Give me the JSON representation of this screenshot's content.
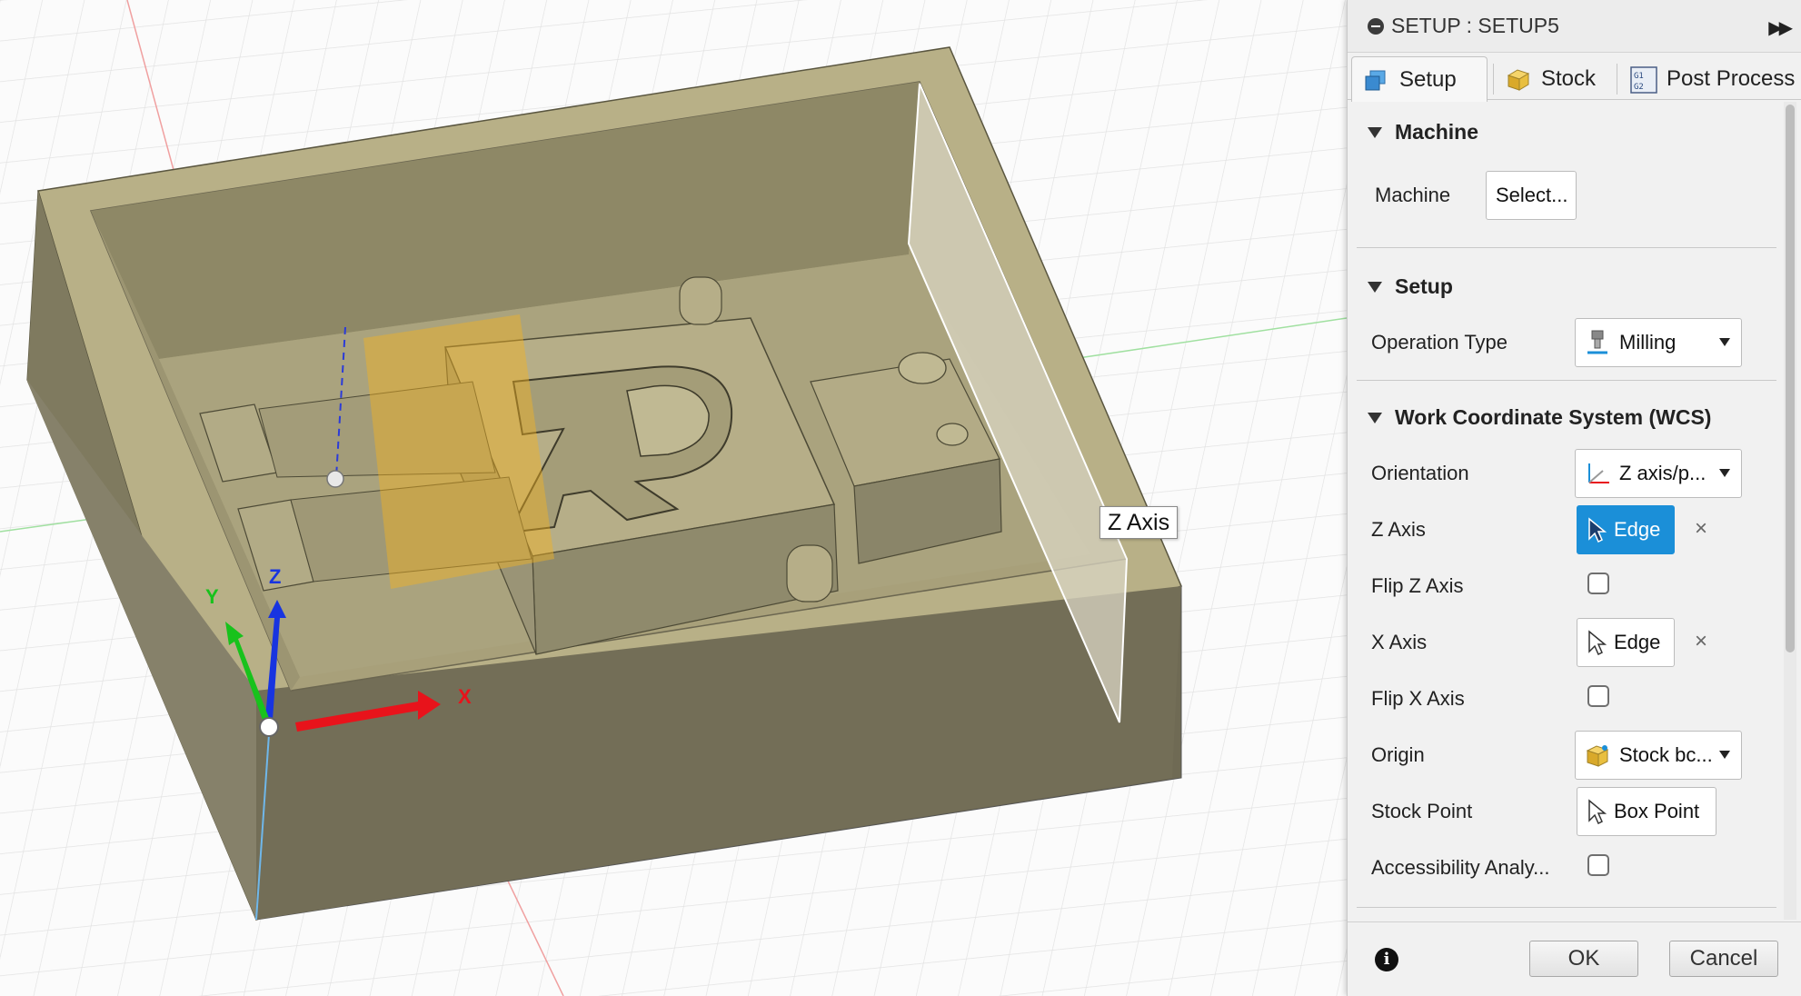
{
  "viewport": {
    "tooltip": "Z Axis",
    "axis_labels": {
      "x": "X",
      "y": "Y",
      "z": "Z"
    }
  },
  "panel": {
    "title": "SETUP : SETUP5",
    "tabs": [
      {
        "label": "Setup",
        "icon": "setup-cube-icon"
      },
      {
        "label": "Stock",
        "icon": "stock-box-icon"
      },
      {
        "label": "Post Process",
        "icon": "gcode-icon"
      }
    ],
    "machine": {
      "heading": "Machine",
      "label": "Machine",
      "button": "Select..."
    },
    "setup": {
      "heading": "Setup",
      "operation_type_label": "Operation Type",
      "operation_type_value": "Milling"
    },
    "wcs": {
      "heading": "Work Coordinate System (WCS)",
      "orientation_label": "Orientation",
      "orientation_value": "Z axis/p...",
      "z_axis_label": "Z Axis",
      "z_axis_value": "Edge",
      "flip_z_label": "Flip Z Axis",
      "x_axis_label": "X Axis",
      "x_axis_value": "Edge",
      "flip_x_label": "Flip X Axis",
      "origin_label": "Origin",
      "origin_value": "Stock bc...",
      "stock_point_label": "Stock Point",
      "stock_point_value": "Box Point",
      "accessibility_label": "Accessibility Analy..."
    },
    "clear_glyph": "×",
    "footer": {
      "ok": "OK",
      "cancel": "Cancel",
      "info": "i"
    }
  },
  "colors": {
    "accent": "#1b8fd8",
    "model_top": "#bcb48a",
    "model_side": "#75705a",
    "axis_x": "#e8131b",
    "axis_y": "#18c21c",
    "axis_z": "#1834e0"
  }
}
